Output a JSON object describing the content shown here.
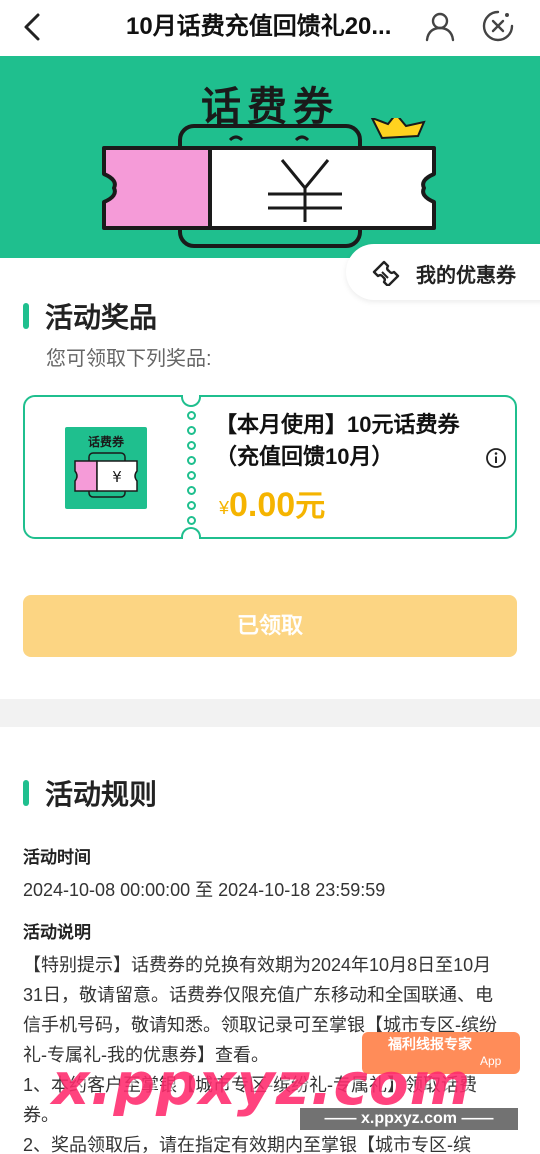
{
  "header": {
    "title": "10月话费充值回馈礼20..."
  },
  "banner": {
    "title": "话费券",
    "my_coupon": "我的优惠券"
  },
  "prizes_section": {
    "title": "活动奖品",
    "subtitle": "您可领取下列奖品:",
    "thumb_title": "话费券",
    "prize_name": "【本月使用】10元话费券（充值回馈10月）",
    "currency": "¥",
    "price": "0.00",
    "price_unit": "元",
    "claim_button": "已领取"
  },
  "rules_section": {
    "title": "活动规则",
    "time_label": "活动时间",
    "time_value": "2024-10-08 00:00:00 至 2024-10-18 23:59:59",
    "desc_label": "活动说明",
    "desc_lines": [
      "【特别提示】话费券的兑换有效期为2024年10月8日至10月31日，敬请留意。话费券仅限充值广东移动和全国联通、电信手机号码，敬请知悉。领取记录可至掌银【城市专区-缤纷礼-专属礼-我的优惠券】查看。",
      "1、本约客户至掌银【城市专区-缤纷礼-专属礼】领取话费券。",
      "2、奖品领取后，请在指定有效期内至掌银【城市专区-缤"
    ]
  },
  "watermark": {
    "main": "x.ppxyz.com",
    "sub": "—— x.ppxyz.com ——",
    "badge_title": "福利线报专家",
    "badge_app": "App"
  }
}
